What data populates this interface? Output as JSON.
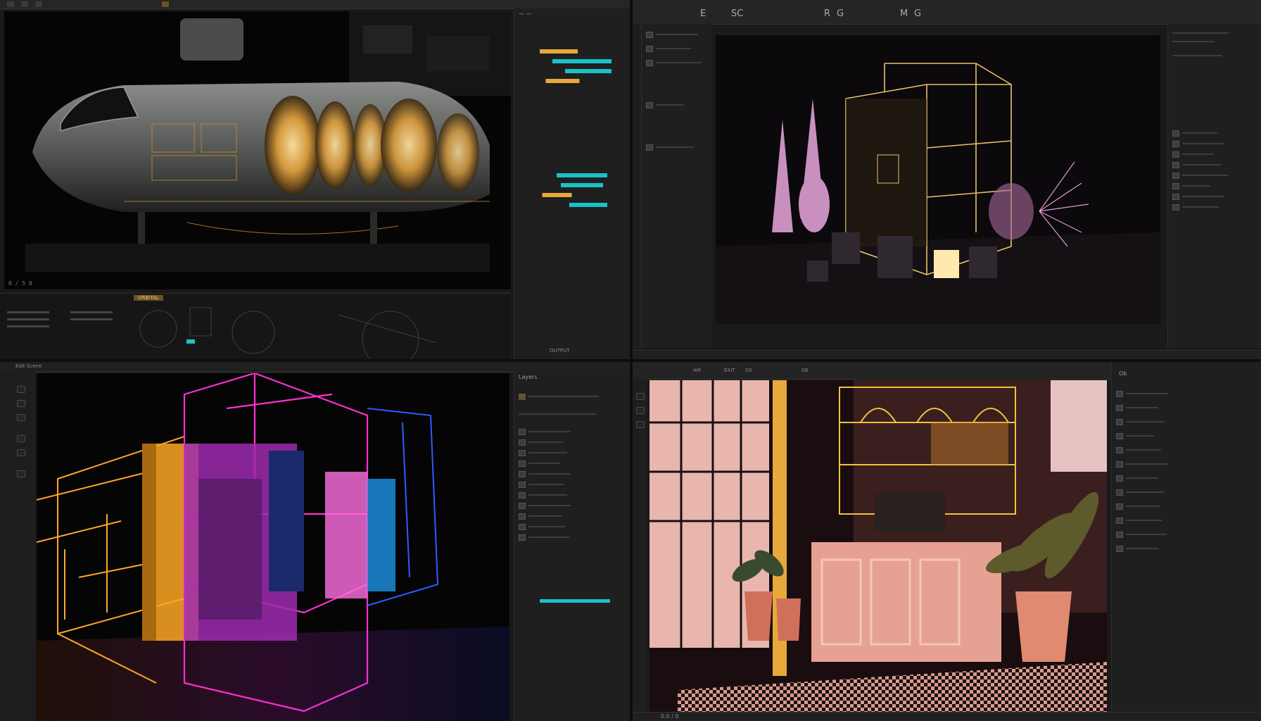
{
  "colors": {
    "accent_gold": "#e8a83a",
    "accent_teal": "#19c2c7",
    "neon_magenta": "#ff2fd1",
    "neon_orange": "#ffa726",
    "neon_blue": "#2b5bff",
    "blush": "#d99a8e"
  },
  "top_left": {
    "label": "0 / 5 0",
    "filmstrip_chip": "ORBITAL",
    "panel_footer": "OUTPUT"
  },
  "top_right": {
    "toolbar_letters": [
      "E",
      "SC",
      "R",
      "G",
      "M",
      "G"
    ]
  },
  "bottom_left": {
    "title": "Edit Scene",
    "panel_title": "Layers"
  },
  "bottom_right": {
    "toolbar_text": [
      "AM",
      "EXIT",
      "OS",
      "SB"
    ],
    "panel_title": "Ob",
    "status": "0.0 / 0"
  },
  "timeline_bars": [
    {
      "color": "#e8a83a",
      "start": 0.05,
      "width": 0.45
    },
    {
      "color": "#19c2c7",
      "start": 0.2,
      "width": 0.7
    },
    {
      "color": "#19c2c7",
      "start": 0.35,
      "width": 0.55
    },
    {
      "color": "#e8a83a",
      "start": 0.12,
      "width": 0.4
    },
    {
      "color": "#19c2c7",
      "start": 0.25,
      "width": 0.6
    },
    {
      "color": "#19c2c7",
      "start": 0.3,
      "width": 0.5
    },
    {
      "color": "#e8a83a",
      "start": 0.08,
      "width": 0.35
    },
    {
      "color": "#19c2c7",
      "start": 0.4,
      "width": 0.45
    }
  ]
}
